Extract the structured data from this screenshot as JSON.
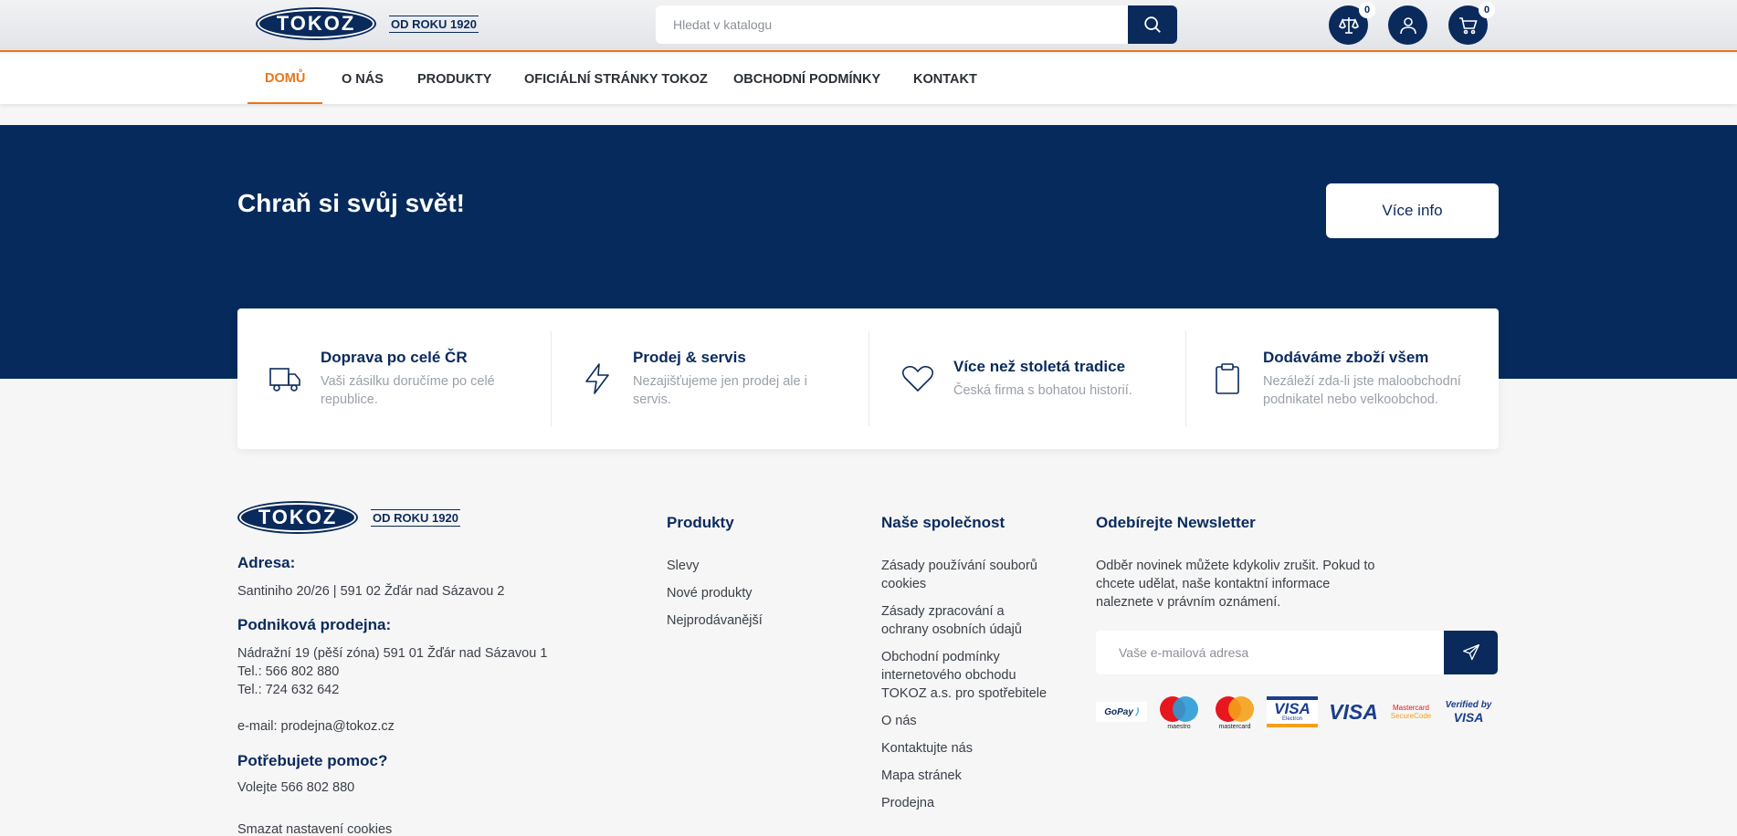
{
  "brand": {
    "name": "TOKOZ",
    "since": "OD ROKU 1920"
  },
  "header": {
    "search_placeholder": "Hledat v katalogu",
    "compare_count": "0",
    "cart_count": "0"
  },
  "nav": [
    "DOMŮ",
    "O NÁS",
    "PRODUKTY",
    "OFICIÁLNÍ STRÁNKY TOKOZ",
    "OBCHODNÍ PODMÍNKY",
    "KONTAKT"
  ],
  "banner": {
    "title": "Chraň si svůj svět!",
    "button": "Více info"
  },
  "features": [
    {
      "icon": "truck-icon",
      "title": "Doprava po celé ČR",
      "desc": [
        "Vaši zásilku doručíme po celé",
        "republice."
      ]
    },
    {
      "icon": "lightning-icon",
      "title": "Prodej & servis",
      "desc": [
        "Nezajišťujeme jen prodej ale i",
        "servis."
      ]
    },
    {
      "icon": "heart-icon",
      "title": "Více než stoletá tradice",
      "desc": [
        "Česká firma s bohatou historií."
      ]
    },
    {
      "icon": "clipboard-icon",
      "title": "Dodáváme zboží všem",
      "desc": [
        "Nezáleží zda-li jste maloobchodní",
        "podnikatel nebo velkoobchod."
      ]
    }
  ],
  "footer": {
    "address_title": "Adresa:",
    "address": "Santiniho 20/26 | 591 02 Žďár nad Sázavou 2",
    "store_title": "Podniková prodejna:",
    "store_address": "Nádražní 19 (pěší zóna) 591 01 Žďár nad Sázavou 1",
    "tel1": "Tel.: 566 802 880",
    "tel2": "Tel.: 724 632 642",
    "email": "e-mail: prodejna@tokoz.cz",
    "help_title": "Potřebujete pomoc?",
    "help_text": "Volejte 566 802 880",
    "cookies_link": "Smazat nastavení cookies",
    "products_title": "Produkty",
    "products_links": [
      "Slevy",
      "Nové produkty",
      "Nejprodávanější"
    ],
    "company_title": "Naše společnost",
    "company_links": [
      [
        "Zásady používání souborů",
        "cookies"
      ],
      [
        "Zásady zpracování a",
        "ochrany osobních údajů"
      ],
      [
        "Obchodní podmínky",
        "internetového obchodu",
        "TOKOZ a.s. pro spotřebitele"
      ],
      [
        "O nás"
      ],
      [
        "Kontaktujte nás"
      ],
      [
        "Mapa stránek"
      ],
      [
        "Prodejna"
      ]
    ],
    "newsletter_title": "Odebírejte Newsletter",
    "newsletter_text": [
      "Odběr novinek můžete kdykoliv zrušit. Pokud to",
      "chcete udělat, naše kontaktní informace",
      "naleznete v právním oznámení."
    ],
    "newsletter_placeholder": "Vaše e-mailová adresa",
    "payments": [
      "GoPay",
      "maestro",
      "mastercard",
      "VISA",
      "Electron",
      "VISA",
      "Mastercard",
      "SecureCode",
      "Verified by",
      "VISA"
    ]
  },
  "colors": {
    "primary": "#0a2a5c",
    "accent": "#e8751a"
  }
}
